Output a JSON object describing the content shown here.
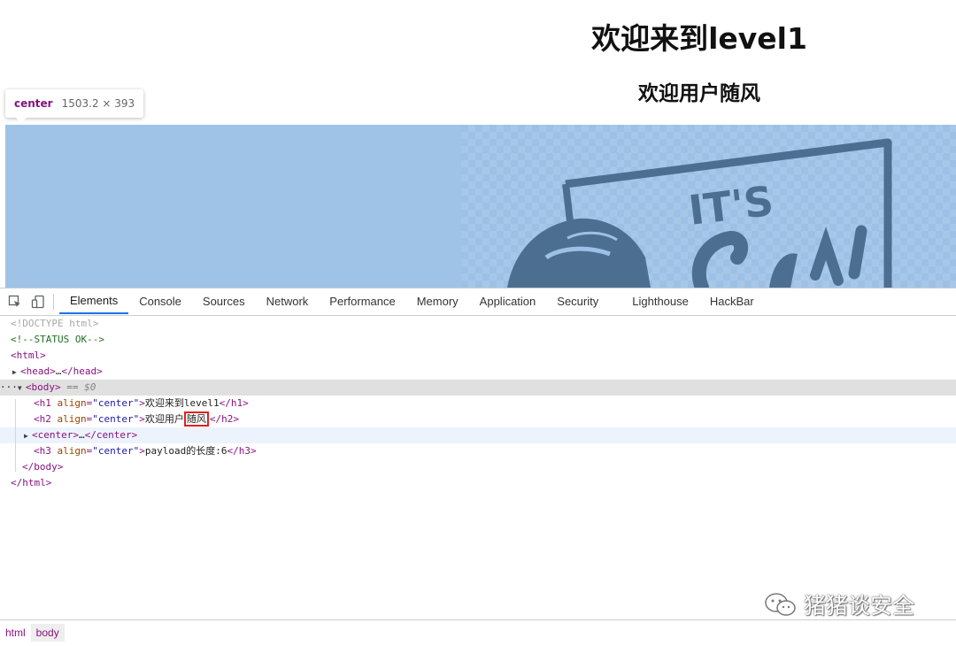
{
  "page": {
    "h1": "欢迎来到level1",
    "h2": "欢迎用户随风"
  },
  "tooltip": {
    "tag": "center",
    "size": "1503.2 × 393"
  },
  "image": {
    "artwork_text": "IT'S"
  },
  "devtools": {
    "tabs": [
      {
        "label": "Elements",
        "active": true
      },
      {
        "label": "Console"
      },
      {
        "label": "Sources"
      },
      {
        "label": "Network"
      },
      {
        "label": "Performance"
      },
      {
        "label": "Memory"
      },
      {
        "label": "Application"
      },
      {
        "label": "Security"
      },
      {
        "label": "Lighthouse"
      },
      {
        "label": "HackBar"
      }
    ],
    "dom": {
      "doctype": "<!DOCTYPE html>",
      "comment": "<!--STATUS OK-->",
      "html_open": "<html>",
      "head_open": "<head>",
      "head_ellipsis": "…",
      "head_close": "</head>",
      "more_dots": "···",
      "body_open": "<body>",
      "body_eq": " == ",
      "body_ref": "$0",
      "h1_open": "<h1",
      "h1_attr": "align",
      "h1_val": "\"center\"",
      "h1_text": "欢迎来到level1",
      "h1_close": "</h1>",
      "h2_open": "<h2",
      "h2_attr": "align",
      "h2_val": "\"center\"",
      "h2_text_before": "欢迎用户",
      "h2_text_boxed": "随风",
      "h2_close": "</h2>",
      "center_open": "<center>",
      "center_ellipsis": "…",
      "center_close": "</center>",
      "h3_open": "<h3",
      "h3_attr": "align",
      "h3_val": "\"center\"",
      "h3_text": "payload的长度:6",
      "h3_close": "</h3>",
      "body_close": "</body>",
      "html_close": "</html>"
    },
    "breadcrumb": [
      "html",
      "body"
    ]
  },
  "watermark": {
    "text": "猪猪谈安全",
    "icon": "wechat-icon"
  },
  "colors": {
    "highlight": "#9fc3e7",
    "tag": "#881280",
    "attr": "#994500",
    "value": "#1a1aa6",
    "comment": "#236e25",
    "active_tab": "#1a73e8",
    "annotation_box": "#e02020"
  }
}
